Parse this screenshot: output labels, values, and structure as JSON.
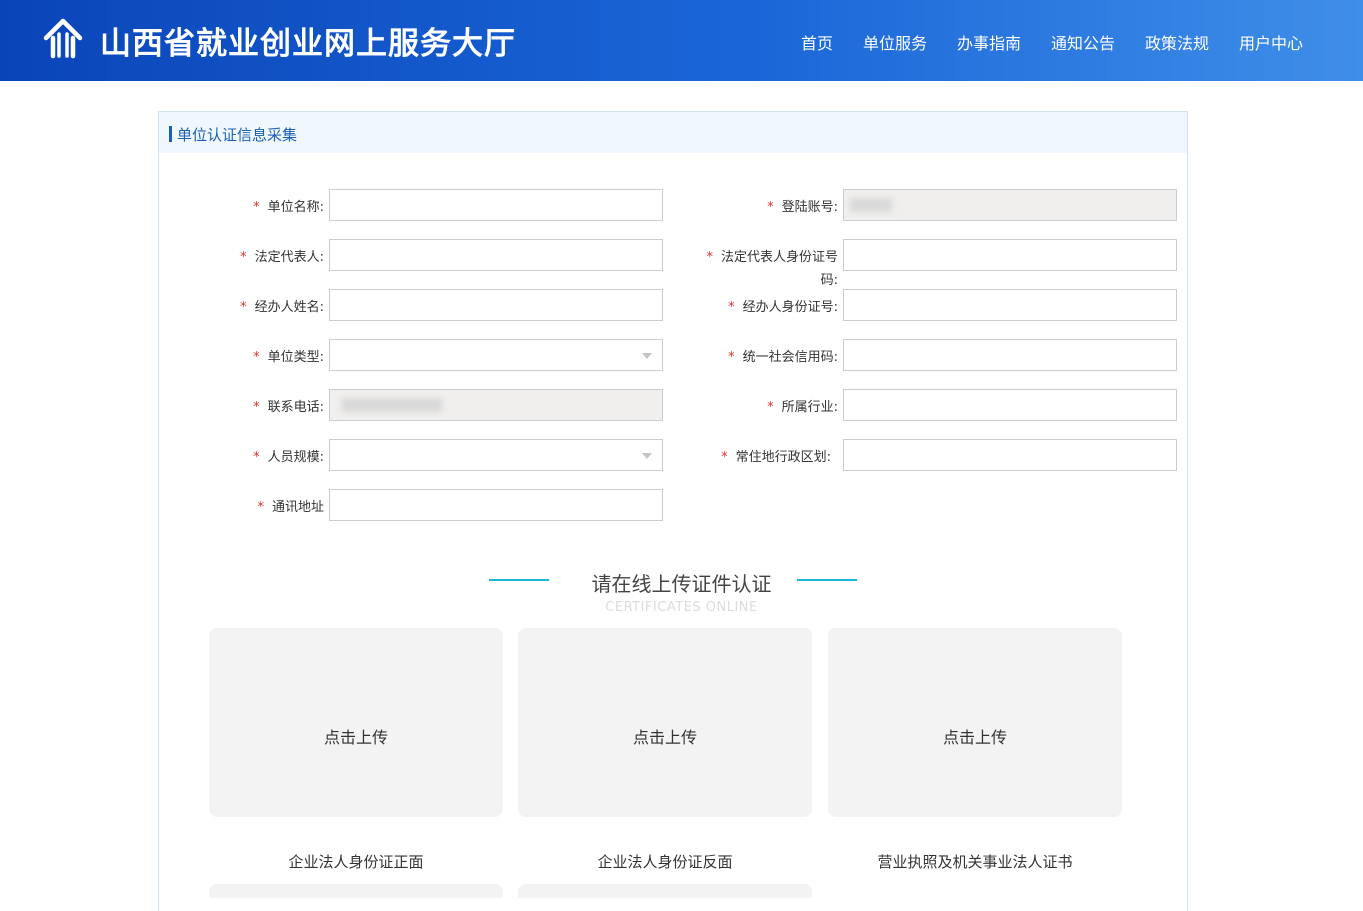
{
  "header": {
    "title": "山西省就业创业网上服务大厅",
    "logo_icon": "building-logo-icon",
    "nav": [
      "首页",
      "单位服务",
      "办事指南",
      "通知公告",
      "政策法规",
      "用户中心"
    ]
  },
  "panel": {
    "title": "单位认证信息采集"
  },
  "form": {
    "required_mark": "*",
    "unit_name": {
      "label": "单位名称:",
      "value": ""
    },
    "login_account": {
      "label": "登陆账号:",
      "value": ""
    },
    "legal_rep": {
      "label": "法定代表人:",
      "value": ""
    },
    "legal_rep_id_line1": "法定代表人身份证号",
    "legal_rep_id_line2": "码:",
    "legal_rep_id_value": "",
    "agent_name": {
      "label": "经办人姓名:",
      "value": ""
    },
    "agent_id": {
      "label": "经办人身份证号:",
      "value": ""
    },
    "unit_type": {
      "label": "单位类型:",
      "value": ""
    },
    "credit_code": {
      "label": "统一社会信用码:",
      "value": ""
    },
    "phone": {
      "label": "联系电话:",
      "value": ""
    },
    "industry": {
      "label": "所属行业:",
      "value": ""
    },
    "staff_scale": {
      "label": "人员规模:",
      "value": ""
    },
    "region": {
      "label": "常住地行政区划:",
      "value": ""
    },
    "address": {
      "label": "通讯地址",
      "value": ""
    }
  },
  "upload_section": {
    "title": "请在线上传证件认证",
    "subtitle": "CERTIFICATES ONLINE",
    "button_text": "点击上传",
    "items": [
      "企业法人身份证正面",
      "企业法人身份证反面",
      "营业执照及机关事业法人证书"
    ]
  },
  "colors": {
    "header_start": "#0a45b8",
    "header_end": "#3f8ee8",
    "accent": "#1c5fb5",
    "required": "#e0312f",
    "section_line": "#1bb7d6"
  }
}
